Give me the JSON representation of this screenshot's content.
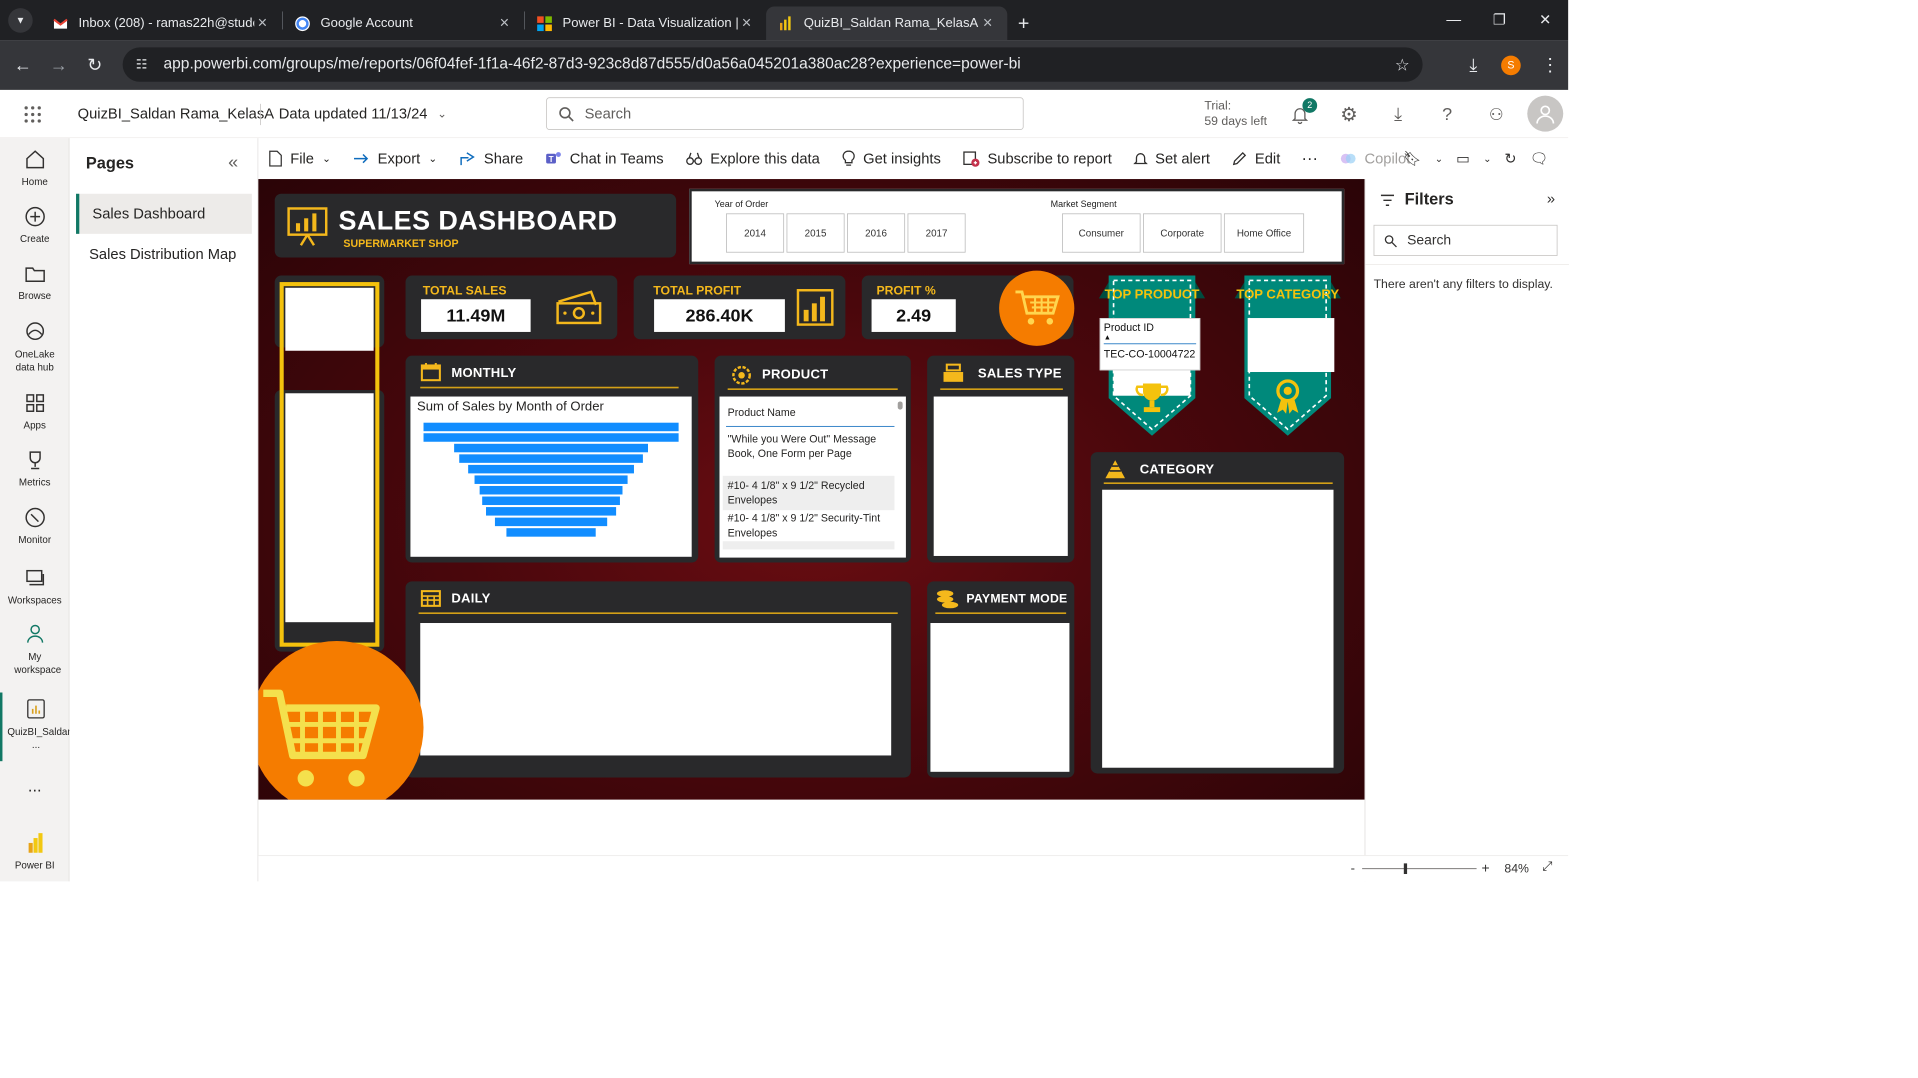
{
  "browser": {
    "tabs": [
      {
        "title": "Inbox (208) - ramas22h@studen",
        "icon": "gmail-icon"
      },
      {
        "title": "Google Account",
        "icon": "google-icon"
      },
      {
        "title": "Power BI - Data Visualization | M",
        "icon": "microsoft-icon"
      },
      {
        "title": "QuizBI_Saldan Rama_KelasA - P",
        "icon": "powerbi-icon",
        "active": true
      }
    ],
    "url": "app.powerbi.com/groups/me/reports/06f04fef-1f1a-46f2-87d3-923c8d87d555/d0a56a045201a380ac28?experience=power-bi",
    "profile_initial": "S",
    "profile_color": "#f57c00"
  },
  "header": {
    "report_title": "QuizBI_Saldan Rama_KelasA",
    "data_updated": "Data updated 11/13/24",
    "search_placeholder": "Search",
    "trial_line1": "Trial:",
    "trial_line2": "59 days left",
    "notification_count": "2"
  },
  "leftnav": {
    "items": [
      {
        "label": "Home",
        "icon": "home-icon"
      },
      {
        "label": "Create",
        "icon": "plus-circle-icon"
      },
      {
        "label": "Browse",
        "icon": "folder-icon"
      },
      {
        "label": "OneLake data hub",
        "icon": "onelake-icon"
      },
      {
        "label": "Apps",
        "icon": "apps-icon"
      },
      {
        "label": "Metrics",
        "icon": "trophy-icon"
      },
      {
        "label": "Monitor",
        "icon": "monitor-icon"
      },
      {
        "label": "Workspaces",
        "icon": "workspaces-icon"
      },
      {
        "label": "My workspace",
        "icon": "person-icon"
      },
      {
        "label": "QuizBI_Saldan ...",
        "icon": "report-icon"
      }
    ],
    "more": "...",
    "brand": "Power BI"
  },
  "pages": {
    "title": "Pages",
    "items": [
      "Sales Dashboard",
      "Sales Distribution Map"
    ],
    "active_index": 0
  },
  "actionbar": {
    "file": "File",
    "export": "Export",
    "share": "Share",
    "chat": "Chat in Teams",
    "explore": "Explore this data",
    "insights": "Get insights",
    "subscribe": "Subscribe to report",
    "alert": "Set alert",
    "edit": "Edit",
    "more": "···",
    "copilot": "Copilot"
  },
  "report": {
    "title": "SALES DASHBOARD",
    "subtitle": "SUPERMARKET SHOP",
    "year_slicer_label": "Year of Order",
    "years": [
      "2014",
      "2015",
      "2016",
      "2017"
    ],
    "segment_slicer_label": "Market Segment",
    "segments": [
      "Consumer",
      "Corporate",
      "Home Office"
    ],
    "kpis": {
      "total_sales_label": "TOTAL SALES",
      "total_sales_value": "11.49M",
      "total_profit_label": "TOTAL PROFIT",
      "total_profit_value": "286.40K",
      "profit_pct_label": "PROFIT %",
      "profit_pct_value": "2.49"
    },
    "top_product_label": "TOP PRODUCT",
    "top_product_field": "Product ID",
    "top_product_value": "TEC-CO-10004722",
    "top_category_label": "TOP CATEGORY",
    "monthly_title": "MONTHLY",
    "monthly_chart_title": "Sum of Sales by Month of Order",
    "product_title": "PRODUCT",
    "product_column": "Product Name",
    "products": [
      "\"While you Were Out\" Message Book, One Form per Page",
      "#10- 4 1/8\" x 9 1/2\" Recycled Envelopes",
      "#10- 4 1/8\" x 9 1/2\" Security-Tint Envelopes"
    ],
    "sales_type_title": "SALES TYPE",
    "category_title": "CATEGORY",
    "daily_title": "DAILY",
    "payment_title": "PAYMENT MODE",
    "accent": "#f4b81c",
    "teal": "#00897b",
    "orange": "#f57c00"
  },
  "chart_data": {
    "type": "bar",
    "title": "Sum of Sales by Month of Order",
    "orientation": "funnel",
    "values": [
      100,
      100,
      76,
      72,
      65,
      60,
      56,
      54,
      51,
      44,
      35
    ]
  },
  "filters": {
    "title": "Filters",
    "search_placeholder": "Search",
    "empty_text": "There aren't any filters to display."
  },
  "status": {
    "zoom": "84%"
  }
}
